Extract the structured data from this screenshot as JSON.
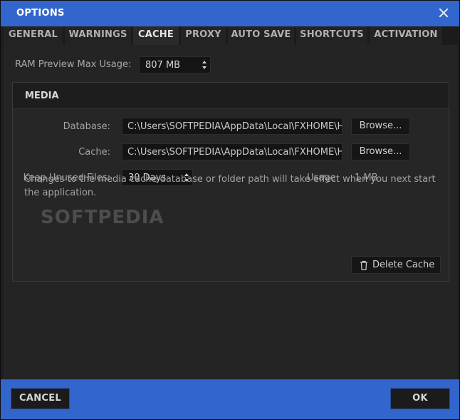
{
  "window": {
    "title": "OPTIONS"
  },
  "tabs": [
    {
      "label": "GENERAL"
    },
    {
      "label": "WARNINGS"
    },
    {
      "label": "CACHE",
      "active": true
    },
    {
      "label": "PROXY"
    },
    {
      "label": "AUTO SAVE"
    },
    {
      "label": "SHORTCUTS"
    },
    {
      "label": "ACTIVATION"
    }
  ],
  "ram_preview": {
    "label": "RAM Preview Max Usage:",
    "value": "807 MB"
  },
  "media": {
    "title": "MEDIA",
    "database_label": "Database:",
    "database_path": "C:\\Users\\SOFTPEDIA\\AppData\\Local\\FXHOME\\Hi",
    "cache_label": "Cache:",
    "cache_path": "C:\\Users\\SOFTPEDIA\\AppData\\Local\\FXHOME\\Hi",
    "browse_label": "Browse...",
    "keep_unused_label": "Keep Unused Files:",
    "keep_unused_value": "30 Days",
    "usage_label": "Usage:",
    "usage_value": "1 MB",
    "note": "Changes to the media cache database or folder path will take effect when you next start the application.",
    "delete_cache_label": "Delete Cache"
  },
  "watermark": "SOFTPEDIA",
  "footer": {
    "cancel_label": "CANCEL",
    "ok_label": "OK"
  },
  "colors": {
    "accent": "#3366cc",
    "background": "#242424"
  },
  "icons": {
    "close": "close-icon",
    "trash": "trash-icon",
    "spinner": "spinner-arrows-icon"
  }
}
